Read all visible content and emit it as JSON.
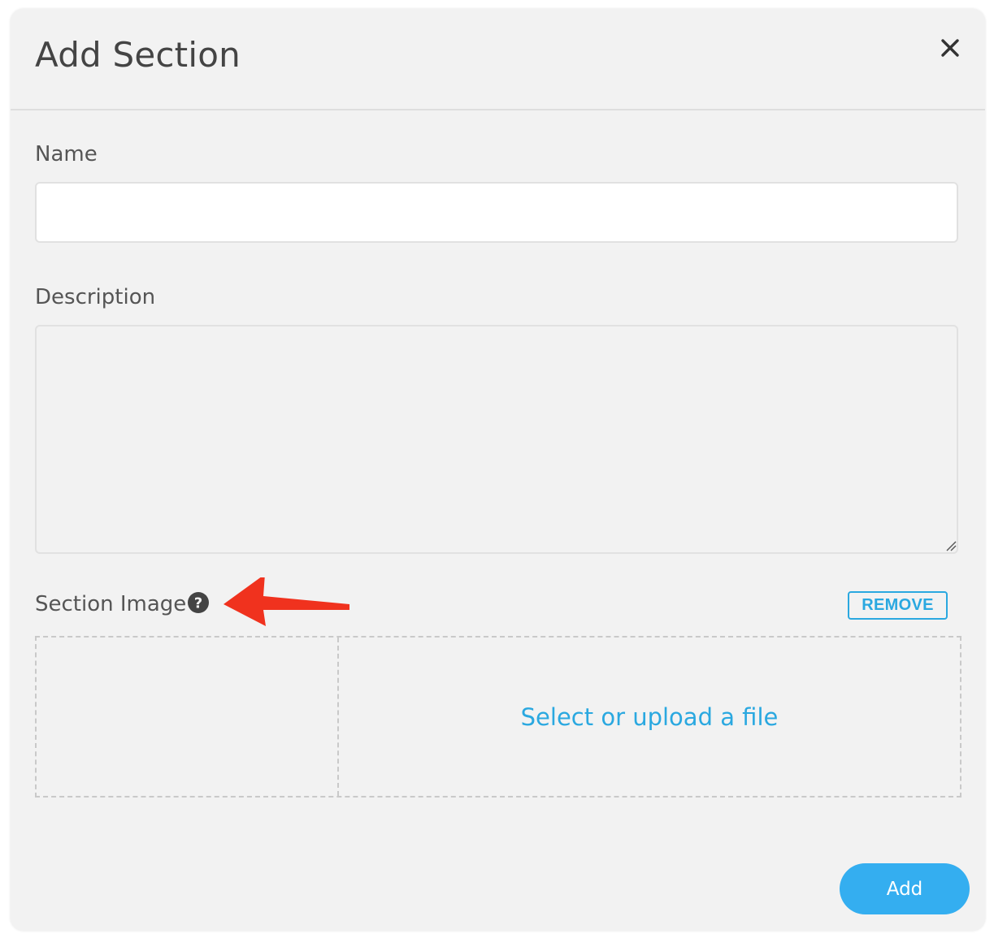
{
  "modal": {
    "title": "Add Section",
    "close_icon": "close-icon"
  },
  "form": {
    "name_label": "Name",
    "name_value": "",
    "description_label": "Description",
    "description_value": "",
    "section_image_label": "Section Image",
    "help_icon": "question-circle-icon",
    "remove_label": "REMOVE",
    "upload_prompt": "Select or upload a file",
    "submit_label": "Add"
  },
  "colors": {
    "accent": "#2aa8e0",
    "primary_button": "#34aef0",
    "annotation_arrow": "#f0321e",
    "modal_background": "#f2f2f2",
    "title_text": "#444444"
  }
}
